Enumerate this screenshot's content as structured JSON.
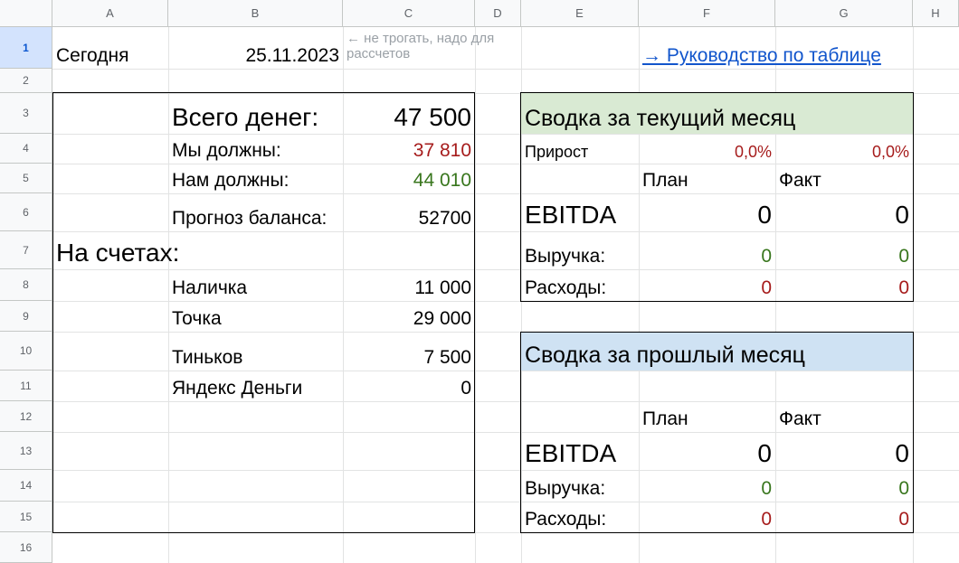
{
  "columns": [
    "A",
    "B",
    "C",
    "D",
    "E",
    "F",
    "G",
    "H"
  ],
  "rows": [
    "1",
    "2",
    "3",
    "4",
    "5",
    "6",
    "7",
    "8",
    "9",
    "10",
    "11",
    "12",
    "13",
    "14",
    "15",
    "16"
  ],
  "selected_row": "1",
  "today": {
    "label": "Сегодня",
    "date": "25.11.2023",
    "note": "← не трогать, надо для рассчетов"
  },
  "guide_link": "→ Руководство по таблице",
  "totals": {
    "total_label": "Всего денег:",
    "total_value": "47 500",
    "we_owe_label": "Мы должны:",
    "we_owe_value": "37 810",
    "owed_to_us_label": "Нам должны:",
    "owed_to_us_value": "44 010",
    "forecast_label": "Прогноз баланса:",
    "forecast_value": "52700"
  },
  "accounts": {
    "title": "На счетах:",
    "items": [
      {
        "name": "Наличка",
        "value": "11 000"
      },
      {
        "name": "Точка",
        "value": "29 000"
      },
      {
        "name": "Тиньков",
        "value": "7 500"
      },
      {
        "name": "Яндекс Деньги",
        "value": "0"
      }
    ]
  },
  "current_month": {
    "title": "Сводка за текущий месяц",
    "growth_label": "Прирост",
    "growth_plan": "0,0%",
    "growth_fact": "0,0%",
    "plan_label": "План",
    "fact_label": "Факт",
    "ebitda_label": "EBITDA",
    "ebitda_plan": "0",
    "ebitda_fact": "0",
    "revenue_label": "Выручка:",
    "revenue_plan": "0",
    "revenue_fact": "0",
    "expenses_label": "Расходы:",
    "expenses_plan": "0",
    "expenses_fact": "0"
  },
  "last_month": {
    "title": "Сводка за прошлый месяц",
    "plan_label": "План",
    "fact_label": "Факт",
    "ebitda_label": "EBITDA",
    "ebitda_plan": "0",
    "ebitda_fact": "0",
    "revenue_label": "Выручка:",
    "revenue_plan": "0",
    "revenue_fact": "0",
    "expenses_label": "Расходы:",
    "expenses_plan": "0",
    "expenses_fact": "0"
  },
  "colors": {
    "green_fill": "#d9ead3",
    "blue_fill": "#cfe2f3",
    "red_text": "#a61c1c",
    "green_text": "#38761d"
  }
}
